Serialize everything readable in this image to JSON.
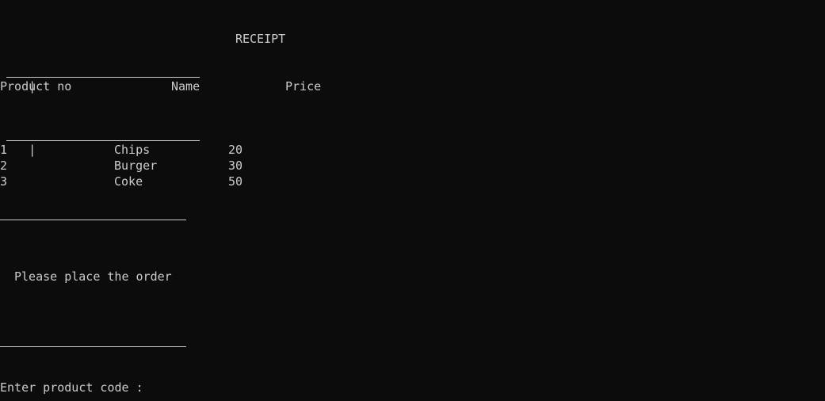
{
  "receipt": {
    "title": "RECEIPT",
    "separator_prefix": "|",
    "headers": {
      "product_no": "Product no",
      "name": "Name",
      "price": "Price"
    },
    "rows": [
      {
        "no": "1",
        "name": "Chips",
        "price": "20"
      },
      {
        "no": "2",
        "name": "Burger",
        "price": "30"
      },
      {
        "no": "3",
        "name": "Coke",
        "price": "50"
      }
    ]
  },
  "order": {
    "message": "Please place the order",
    "prompt": "Enter product code :"
  }
}
